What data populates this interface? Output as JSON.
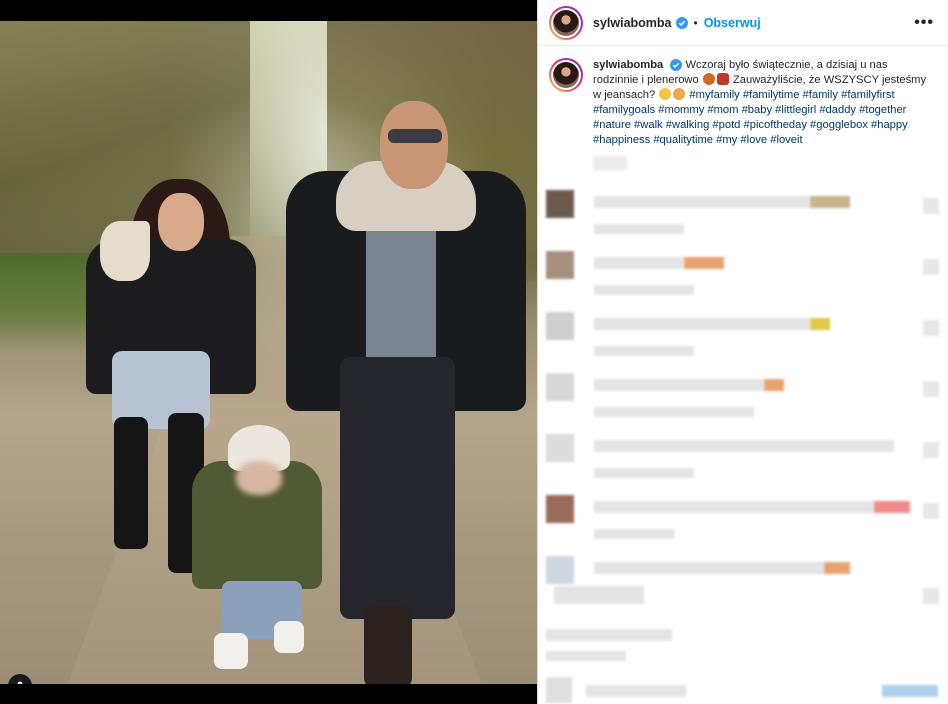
{
  "post": {
    "username": "sylwiabomba",
    "follow_label": "Obserwuj",
    "separator": "•",
    "more_label": "•••",
    "caption_text": "Wczoraj było świątecznie, a dzisiaj u nas rodzinnie i plenerowo",
    "caption_text_2": "Zauważyliście, że WSZYSCY jesteśmy w jeansach?",
    "hashtags": "#myfamily #familytime #family #familyfirst #familygoals #mommy #mom #baby #littlegirl #daddy #together #nature #walk #walking #potd #picoftheday #gogglebox #happy #happiness #qualitytime #my #love #loveit"
  },
  "icons": {
    "verified": "verified-badge-icon",
    "tag": "user-tag-icon",
    "more": "more-options-icon"
  },
  "colors": {
    "accent": "#0095f6",
    "hashtag": "#00376b",
    "verified": "#3897f0",
    "text": "#262626"
  }
}
